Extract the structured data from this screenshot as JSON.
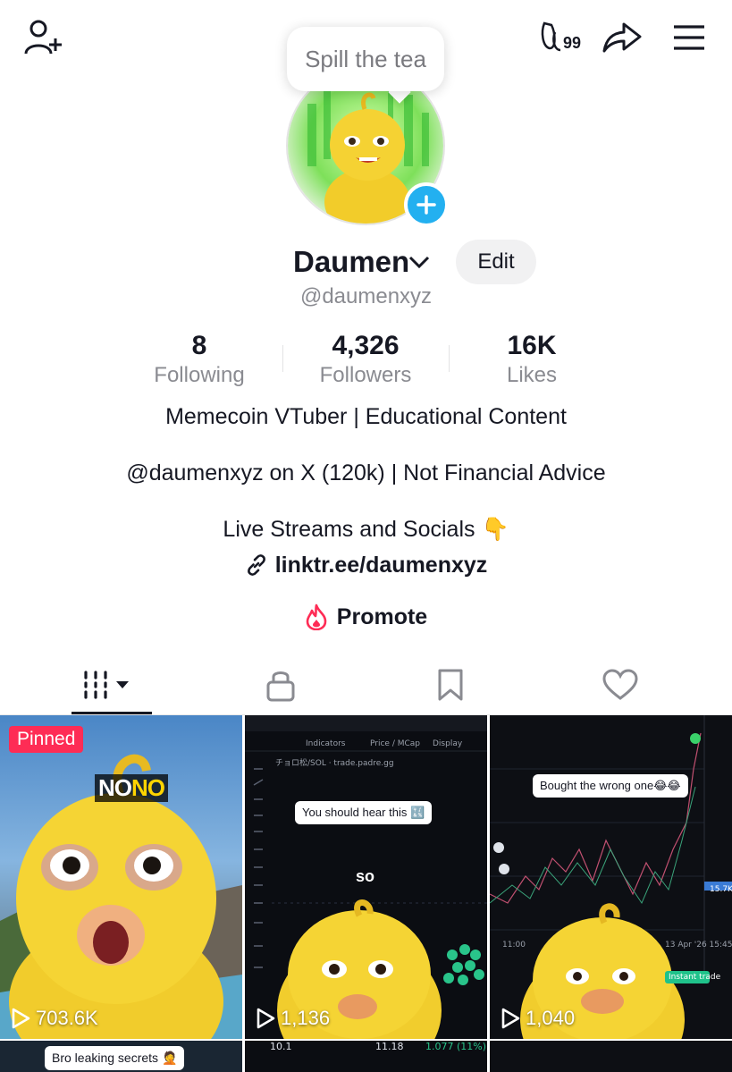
{
  "tooltip": {
    "text": "Spill the tea"
  },
  "profile": {
    "display_name": "Daumen",
    "edit_label": "Edit",
    "handle": "@daumenxyz"
  },
  "memo_badge": "99",
  "stats": [
    {
      "value": "8",
      "label": "Following"
    },
    {
      "value": "4,326",
      "label": "Followers"
    },
    {
      "value": "16K",
      "label": "Likes"
    }
  ],
  "bio": {
    "line1": "Memecoin VTuber | Educational Content",
    "line2": "@daumenxyz on X (120k) | Not Financial Advice",
    "line3": "Live Streams and Socials 👇",
    "link": "linktr.ee/daumenxyz",
    "promote": "Promote"
  },
  "videos": [
    {
      "pinned": "Pinned",
      "overlay": "NO",
      "overlay2": "NO",
      "views": "703.6K"
    },
    {
      "caption": "You should hear this 🔣",
      "subtitle": "so",
      "views": "1,136",
      "chart_header": "Indicators",
      "chart_pair": "チョロ松/SOL · trade.padre.gg",
      "price_label": "Price / MCap",
      "display_label": "Display"
    },
    {
      "caption": "Bought the wrong one😂😂",
      "views": "1,040",
      "axis_price": "15.7K",
      "date_label": "13 Apr '26 15:45",
      "time_label": "11:00",
      "instant_trade": "Instant trade"
    },
    {
      "caption": "Bro leaking secrets 🤦"
    },
    {
      "stats_a": "10.1",
      "stats_b": "11.18",
      "stats_c": "1.077 (11%)"
    },
    {}
  ],
  "colors": {
    "accent": "#fe2c55",
    "avatar_plus": "#23b0f0",
    "promote": "#fe2c55"
  }
}
